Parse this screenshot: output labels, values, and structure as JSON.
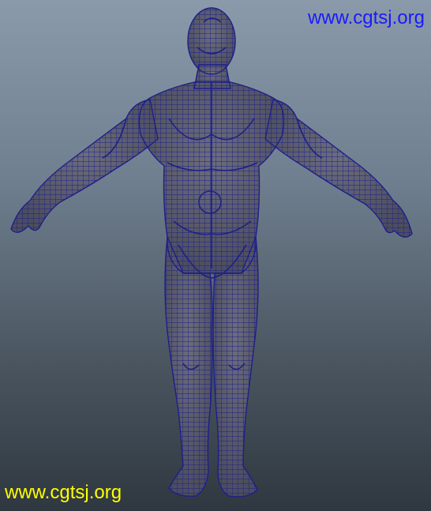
{
  "viewport": {
    "background_top": "#8a9aab",
    "background_bottom": "#2f3840",
    "mesh_fill": "#5c5d6e",
    "wire_color": "#1d1f8a"
  },
  "model": {
    "icon": "human-wireframe-mesh"
  },
  "watermarks": {
    "top_text": "www.cgtsj.org",
    "top_color": "#1a1aff",
    "bottom_text": "www.cgtsj.org",
    "bottom_color": "#ffff00"
  }
}
